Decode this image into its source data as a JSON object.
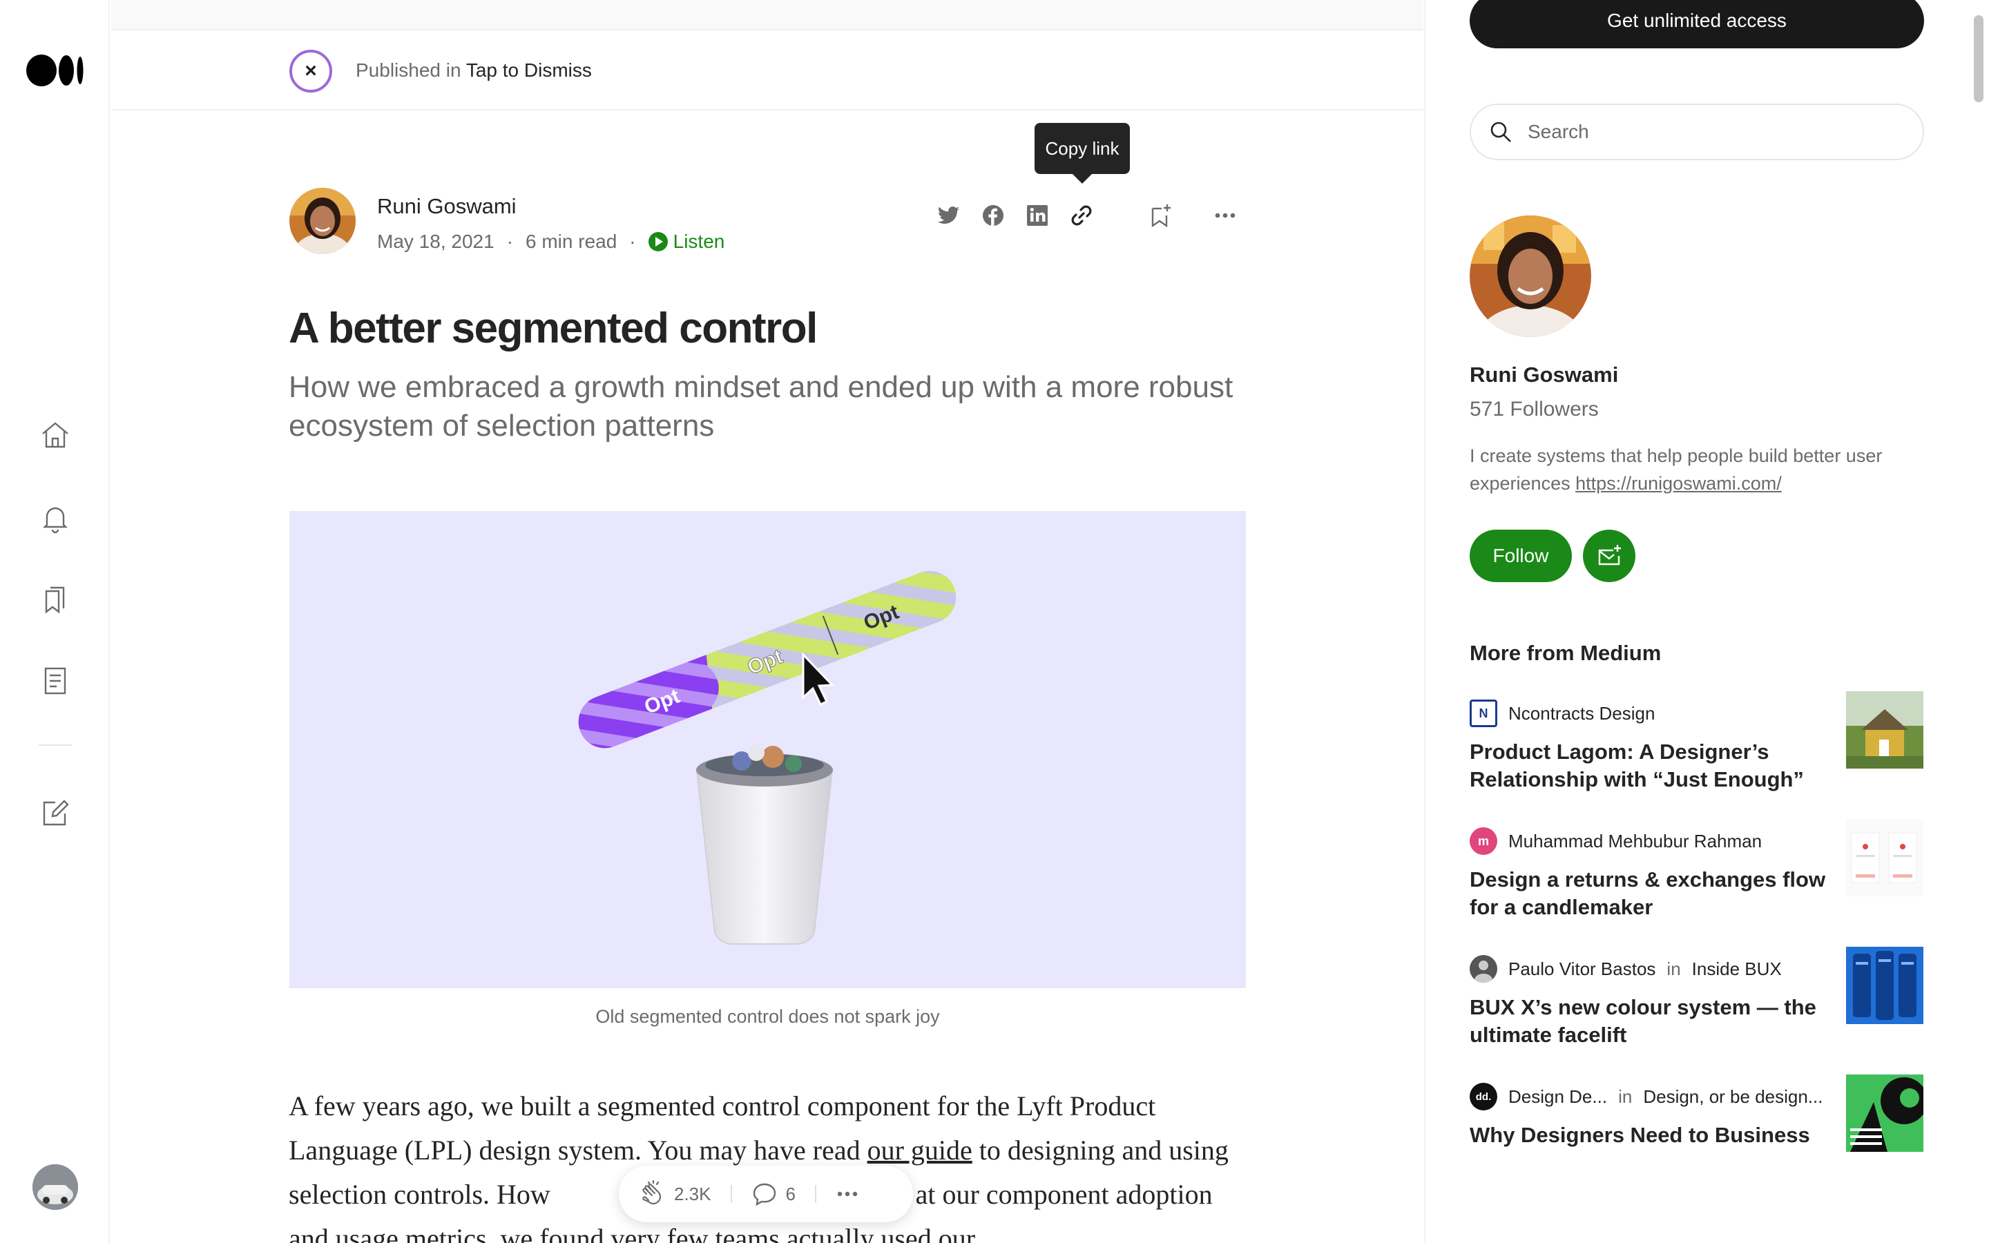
{
  "publication": {
    "label": "Published in",
    "name": "Tap to Dismiss"
  },
  "author": {
    "name": "Runi Goswami",
    "date": "May 18, 2021",
    "read_time": "6 min read",
    "listen_label": "Listen"
  },
  "share": {
    "tooltip": "Copy link"
  },
  "article": {
    "title": "A better segmented control",
    "subtitle": "How we embraced a growth mindset and ended up with a more robust ecosystem of selection patterns",
    "image_caption": "Old segmented control does not spark joy",
    "image_labels": [
      "Opt",
      "Opt",
      "Opt"
    ],
    "body_p1_before_link": "A few years ago, we built a segmented control component for the Lyft Product Language (LPL) design system. You may have read ",
    "body_link": "our guide",
    "body_p1_after_link": " to designing and using selection controls. How",
    "body_p1_tail": "looked at our component adoption and usage metrics, we found very few teams actually used our"
  },
  "clap_bar": {
    "claps": "2.3K",
    "responses": "6"
  },
  "sidebar": {
    "cta": "Get unlimited access",
    "search_placeholder": "Search",
    "profile_name": "Runi Goswami",
    "followers": "571 Followers",
    "bio": "I create systems that help people build better user experiences ",
    "bio_link": "https://runigoswami.com/",
    "follow_label": "Follow",
    "more_title": "More from Medium",
    "recommendations": [
      {
        "author": "Ncontracts Design",
        "in": "",
        "publication": "",
        "title": "Product Lagom: A Designer’s Relationship with “Just Enough”",
        "icon_text": "N",
        "icon_color": "#1b3a8c"
      },
      {
        "author": "Muhammad Mehbubur Rahman",
        "in": "",
        "publication": "",
        "title": "Design a returns & exchanges flow for a candlemaker",
        "icon_text": "m",
        "icon_color": "#e0457b"
      },
      {
        "author": "Paulo Vitor Bastos",
        "in": "in",
        "publication": "Inside BUX",
        "title": "BUX X’s new colour system — the ultimate facelift",
        "icon_text": "",
        "icon_color": "#555555"
      },
      {
        "author": "Design De...",
        "in": "in",
        "publication": "Design, or be design...",
        "title": "Why Designers Need to Business",
        "icon_text": "dd.",
        "icon_color": "#111111"
      }
    ]
  },
  "colors": {
    "brand_green": "#1a8917",
    "hero_bg": "#e9e7fd",
    "cta_bg": "#191919"
  },
  "icons": [
    "medium-logo-icon",
    "home-icon",
    "bell-icon",
    "bookmarks-icon",
    "stories-icon",
    "write-icon",
    "twitter-icon",
    "facebook-icon",
    "linkedin-icon",
    "link-icon",
    "bookmark-add-icon",
    "more-icon",
    "clap-icon",
    "comment-icon",
    "search-icon",
    "subscribe-mail-icon"
  ]
}
